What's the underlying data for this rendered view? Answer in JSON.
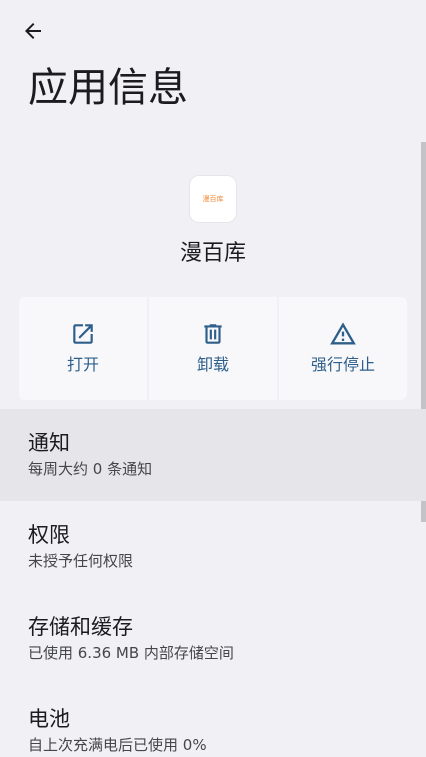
{
  "header": {
    "title": "应用信息"
  },
  "app": {
    "name": "漫百库",
    "icon_text": "漫百库"
  },
  "actions": [
    {
      "label": "打开",
      "icon": "open-external-icon"
    },
    {
      "label": "卸载",
      "icon": "trash-icon"
    },
    {
      "label": "强行停止",
      "icon": "warning-icon"
    }
  ],
  "settings": [
    {
      "title": "通知",
      "subtitle": "每周大约 0 条通知"
    },
    {
      "title": "权限",
      "subtitle": "未授予任何权限"
    },
    {
      "title": "存储和缓存",
      "subtitle": "已使用 6.36 MB 内部存储空间"
    },
    {
      "title": "电池",
      "subtitle": "自上次充满电后已使用 0%"
    }
  ],
  "colors": {
    "background": "#f1f0f5",
    "action_accent": "#2e5f8a",
    "highlight_row": "#e6e5ea"
  }
}
